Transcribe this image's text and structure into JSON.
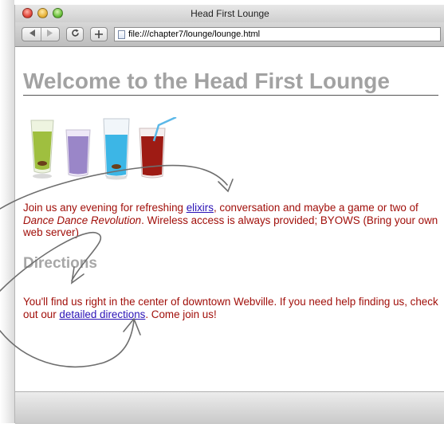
{
  "window": {
    "title": "Head First Lounge"
  },
  "toolbar": {
    "back_icon": "back-arrow-icon",
    "forward_icon": "forward-arrow-icon",
    "reload_icon": "reload-icon",
    "add_icon": "add-bookmark-icon",
    "address": "file:///chapter7/lounge/lounge.html"
  },
  "page": {
    "heading": "Welcome to the Head First Lounge",
    "intro": {
      "before_link": "Join us any evening for refreshing ",
      "link": "elixirs",
      "after_link": ", conversation and maybe a game or two of ",
      "emphasis": "Dance Dance Revolution",
      "rest": ". Wireless access is always provided; BYOWS (Bring your own web server)."
    },
    "directions_heading": "Directions",
    "directions": {
      "before_link": "You'll find us right in the center of downtown Webville. If you need help finding us, check out our ",
      "link": "detailed directions",
      "after_link": ". Come join us!"
    }
  },
  "colors": {
    "heading": "#a2a2a2",
    "body_text": "#a10f0a",
    "link": "#2a12b6",
    "annotation_arrow": "#6e6e6e"
  }
}
